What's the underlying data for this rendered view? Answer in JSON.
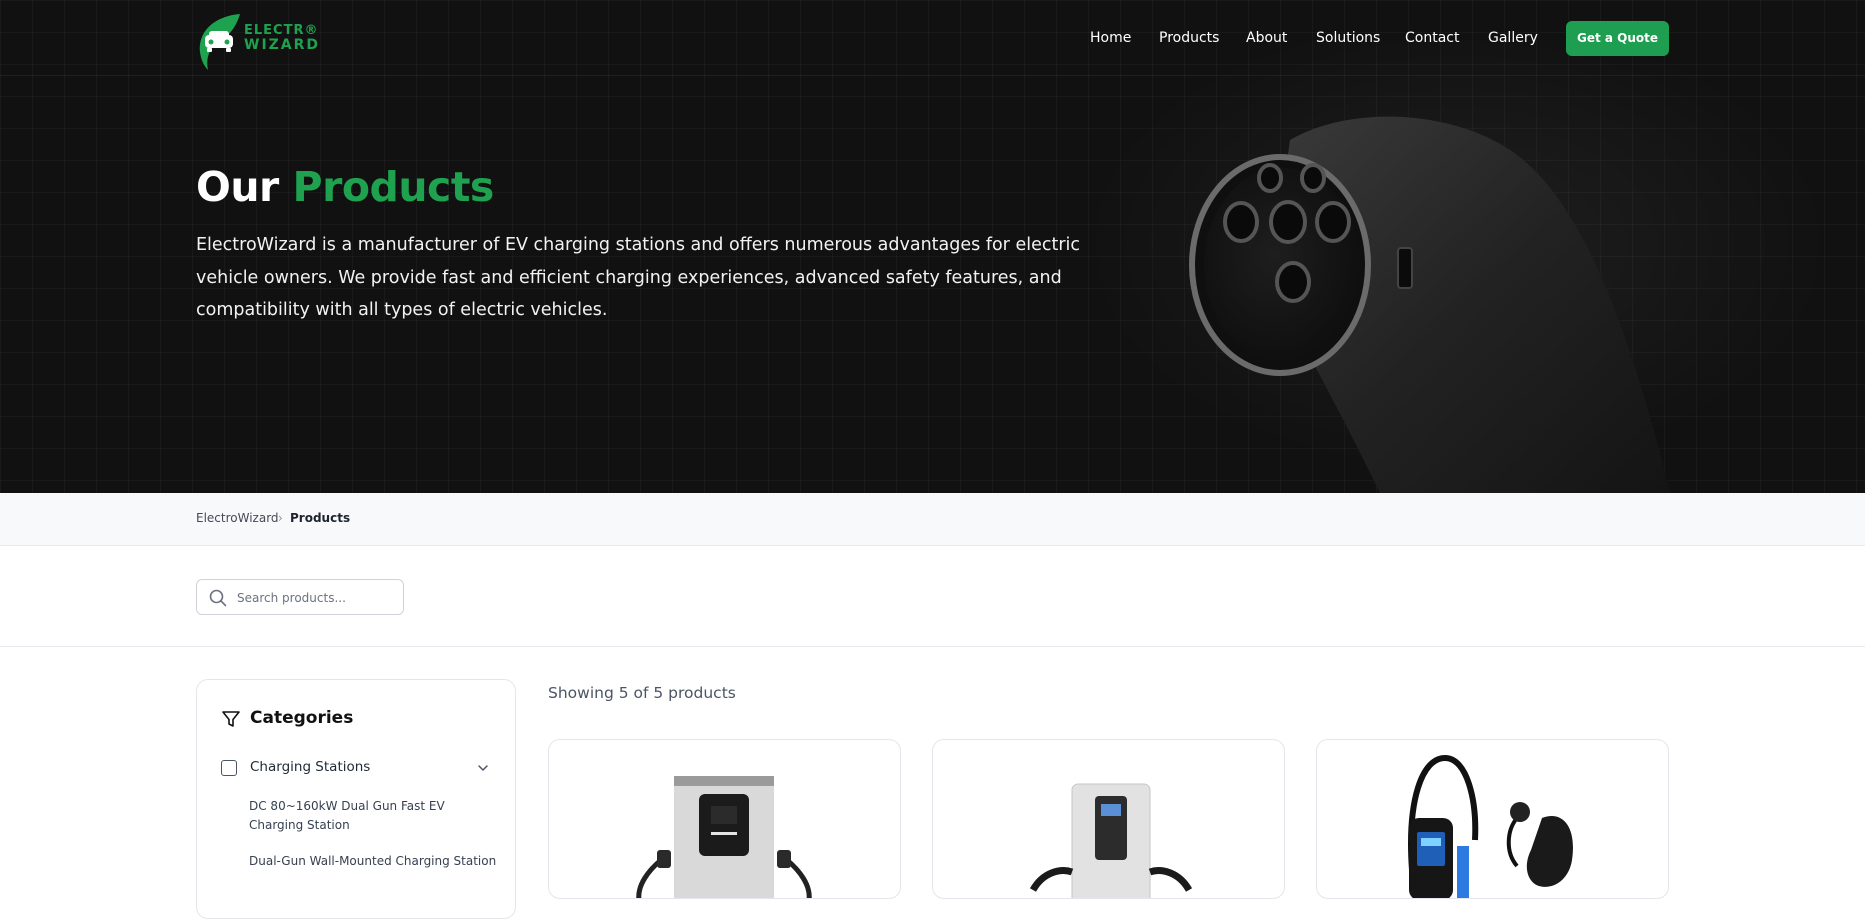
{
  "brand": {
    "name_line1": "ELECTR®",
    "name_line2": "WIZARD",
    "accent_color": "#1ea24f"
  },
  "nav": {
    "items": [
      {
        "label": "Home"
      },
      {
        "label": "Products"
      },
      {
        "label": "About"
      },
      {
        "label": "Solutions"
      },
      {
        "label": "Contact"
      },
      {
        "label": "Gallery"
      }
    ],
    "cta_label": "Get a Quote"
  },
  "hero": {
    "title_plain": "Our",
    "title_accent": "Products",
    "description": "ElectroWizard is a manufacturer of EV charging stations and offers numerous advantages for electric vehicle owners. We provide fast and efficient charging experiences, advanced safety features, and compatibility with all types of electric vehicles."
  },
  "breadcrumb": {
    "home": "ElectroWizard",
    "separator": "›",
    "current": "Products"
  },
  "search": {
    "placeholder": "Search products..."
  },
  "sidebar": {
    "title": "Categories",
    "category": {
      "label": "Charging Stations",
      "checked": false,
      "subitems": [
        {
          "label": "DC 80~160kW Dual Gun Fast EV Charging Station"
        },
        {
          "label": "Dual-Gun Wall-Mounted Charging Station"
        }
      ]
    }
  },
  "results": {
    "summary": "Showing 5 of 5 products"
  },
  "icons": {
    "search": "search-icon",
    "filter": "filter-icon",
    "chevron": "chevron-down-icon",
    "logo": "car-leaf-logo"
  }
}
